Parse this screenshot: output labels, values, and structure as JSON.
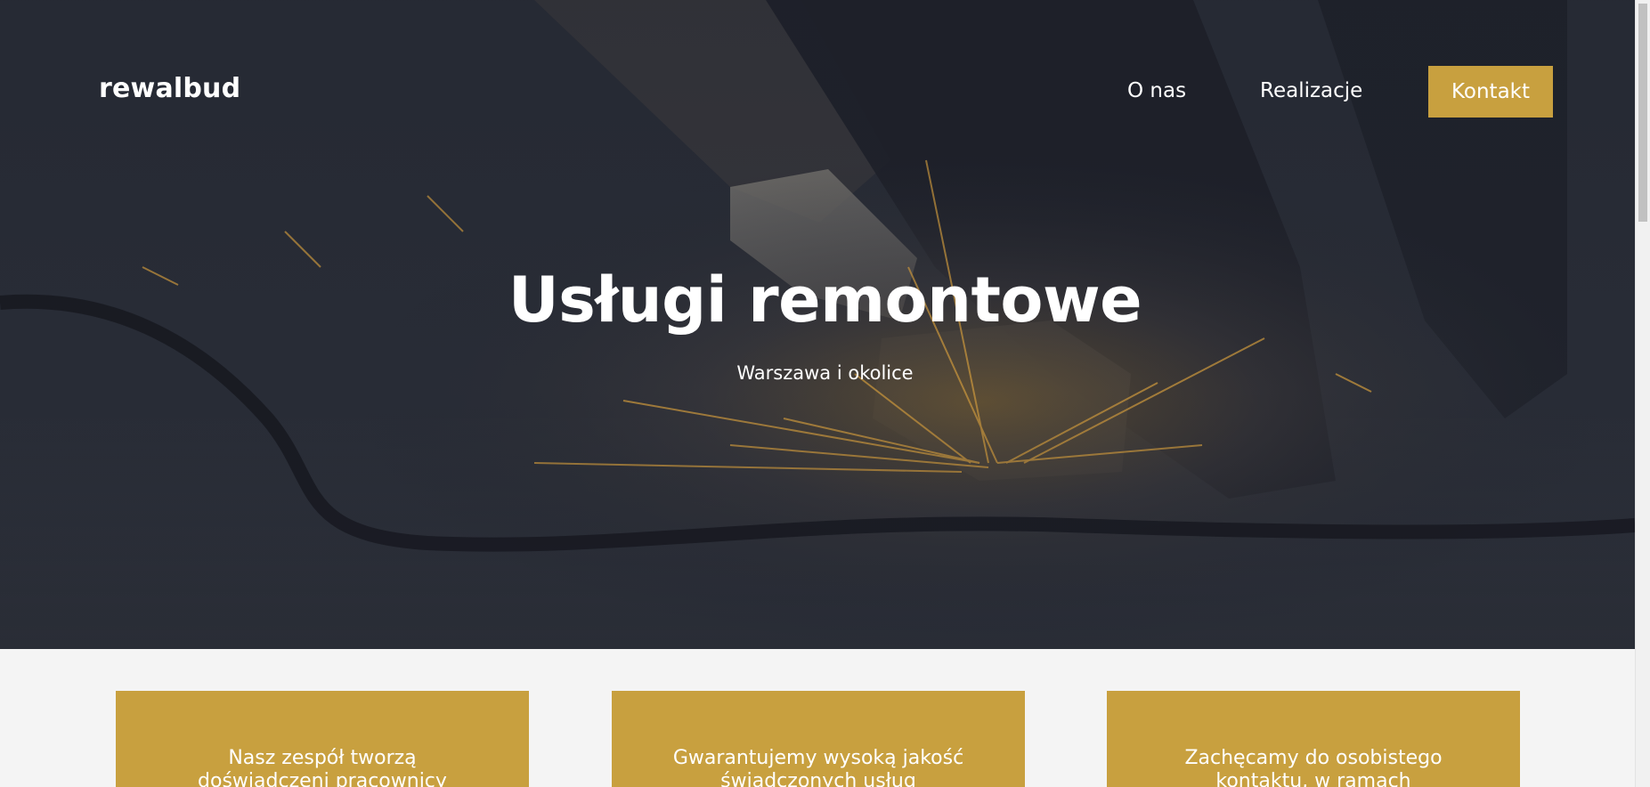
{
  "header": {
    "logo": "rewalbud",
    "nav": {
      "o_nas": "O nas",
      "realizacje": "Realizacje",
      "kontakt": "Kontakt"
    }
  },
  "hero": {
    "title": "Usługi remontowe",
    "subtitle": "Warszawa i okolice"
  },
  "features": {
    "cards": [
      {
        "text": "Nasz zespół tworzą doświadczeni pracownicy"
      },
      {
        "text": "Gwarantujemy wysoką jakość świadczonych usług"
      },
      {
        "text": "Zachęcamy do osobistego kontaktu, w ramach"
      }
    ]
  },
  "colors": {
    "accent": "#c8a03f",
    "hero_dark": "#262a33",
    "section_bg": "#f4f4f4",
    "text_light": "#ffffff"
  }
}
